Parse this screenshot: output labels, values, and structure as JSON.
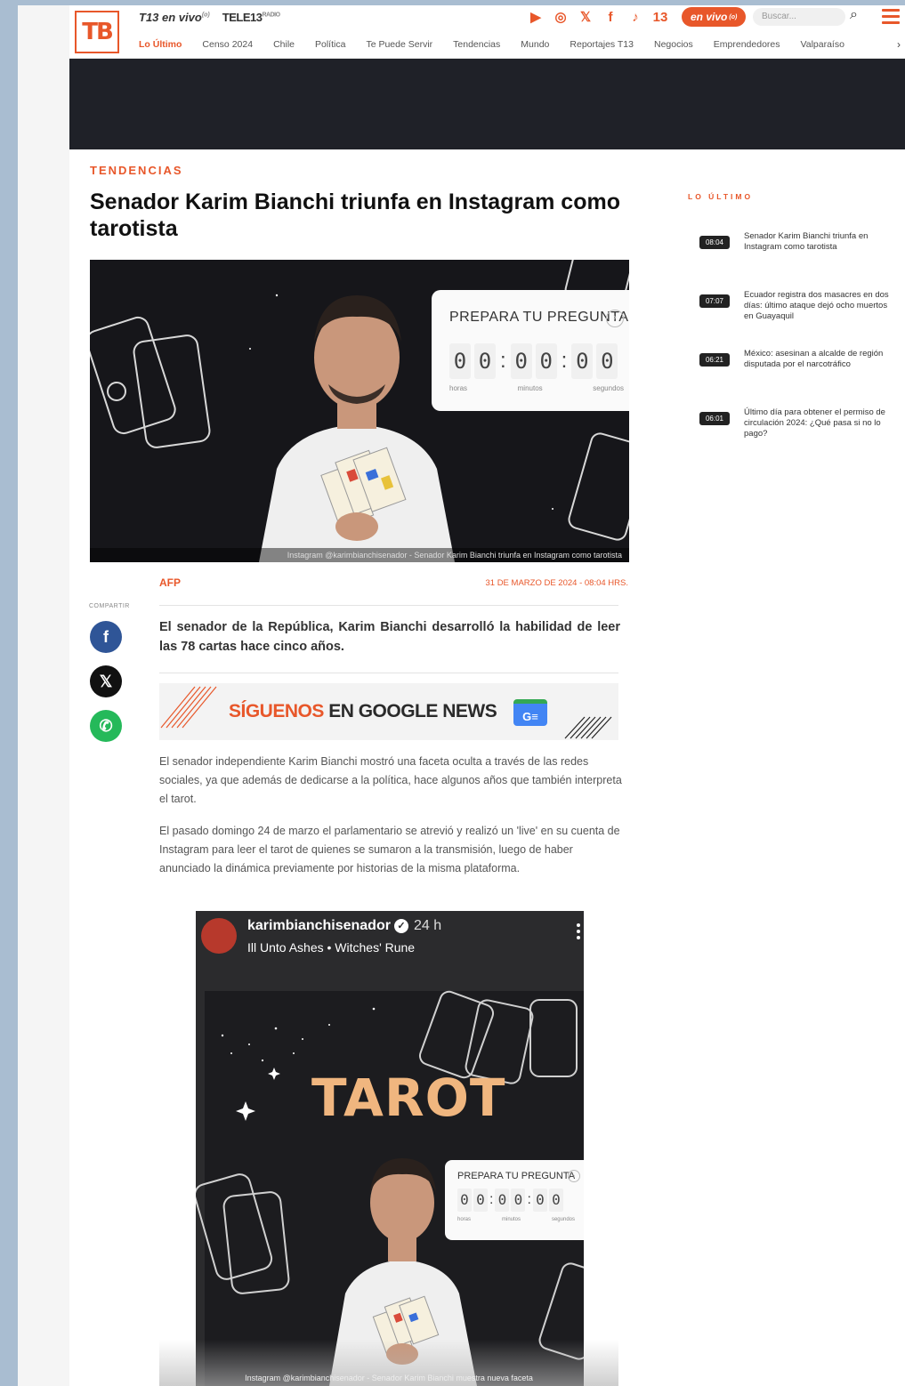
{
  "header": {
    "logo": "TB",
    "live_links": [
      {
        "label": "T13 en vivo",
        "sup": "(o)"
      },
      {
        "label": "TELE13",
        "sup": "RADIO"
      }
    ],
    "social_icons": [
      "youtube-icon",
      "instagram-icon",
      "x-icon",
      "facebook-icon",
      "tiktok-icon",
      "t13-icon"
    ],
    "envivo_label": "en vivo",
    "envivo_sup": "(o)",
    "search_placeholder": "Buscar...",
    "accent_color": "#e8572a"
  },
  "nav": {
    "items": [
      "Lo Último",
      "Censo 2024",
      "Chile",
      "Política",
      "Te Puede Servir",
      "Tendencias",
      "Mundo",
      "Reportajes T13",
      "Negocios",
      "Emprendedores",
      "Valparaíso"
    ],
    "active_index": 0,
    "more_arrow": "›"
  },
  "article": {
    "section": "TENDENCIAS",
    "title": "Senador Karim Bianchi triunfa en Instagram como tarotista",
    "hero": {
      "countdown_title": "PREPARA TU PREGUNTA",
      "digits": [
        "0",
        "0",
        "0",
        "0",
        "0",
        "0"
      ],
      "labels": [
        "horas",
        "minutos",
        "segundos"
      ],
      "caption": "Instagram @karimbianchisenador - Senador Karim Bianchi triunfa en Instagram como tarotista"
    },
    "share_label": "COMPARTIR",
    "author": "AFP",
    "date": "31 DE MARZO DE 2024 - 08:04 HRS.",
    "lead": "El senador de la República, Karim Bianchi desarrolló la habilidad de leer las 78 cartas hace cinco años.",
    "google_news": {
      "part1": "SÍGUENOS",
      "part2": " EN GOOGLE NEWS",
      "icon_text": "G≡"
    },
    "paragraphs": [
      "El senador independiente Karim Bianchi mostró una faceta oculta a través de las redes sociales, ya que además de dedicarse a la política, hace algunos años que también interpreta el tarot.",
      "El pasado domingo 24 de marzo el parlamentario se atrevió y realizó un 'live' en su cuenta de Instagram para leer el tarot de quienes se sumaron a la transmisión, luego de haber anunciado la dinámica previamente por historias de la misma plataforma."
    ],
    "embed": {
      "username": "karimbianchisenador",
      "time_ago": "24 h",
      "music": "Ill Unto Ashes • Witches' Rune",
      "tarot_word": "TAROT",
      "countdown_title": "PREPARA TU PREGUNTA",
      "digits": [
        "0",
        "0",
        "0",
        "0",
        "0",
        "0"
      ],
      "labels": [
        "horas",
        "minutos",
        "segundos"
      ],
      "caption": "Instagram @karimbianchisenador - Senador Karim Bianchi muestra nueva faceta"
    }
  },
  "sidebar": {
    "label": "LO ÚLTIMO",
    "items": [
      {
        "time": "08:04",
        "text": "Senador Karim Bianchi triunfa en Instagram como tarotista"
      },
      {
        "time": "07:07",
        "text": "Ecuador registra dos masacres en dos días: último ataque dejó ocho muertos en Guayaquil"
      },
      {
        "time": "06:21",
        "text": "México: asesinan a alcalde de región disputada por el narcotráfico"
      },
      {
        "time": "06:01",
        "text": "Último día para obtener el permiso de circulación 2024: ¿Qué pasa si no lo pago?"
      }
    ]
  }
}
